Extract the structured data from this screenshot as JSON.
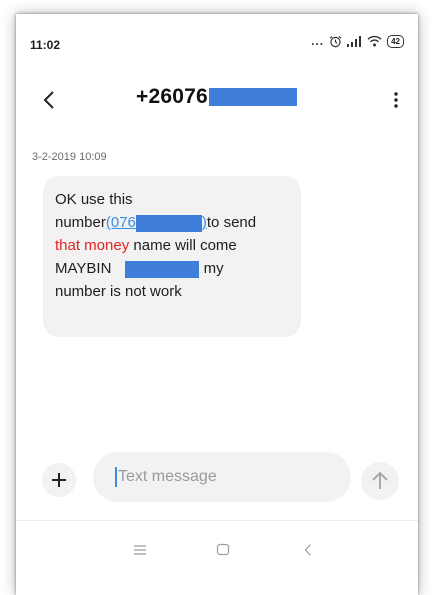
{
  "status_bar": {
    "time": "11:02",
    "dots": "...",
    "battery": "42",
    "icons": [
      "alarm-icon",
      "signal-icon",
      "wifi-icon",
      "battery-icon"
    ]
  },
  "header": {
    "title": "+26076",
    "back_icon": "chevron-left-icon",
    "more_icon": "more-vertical-icon"
  },
  "conversation": {
    "timestamp": "3-2-2019 10:09",
    "message": {
      "line1": "OK use this",
      "line2_prefix": "number",
      "line2_link": "(076",
      "line2_link_close": ")",
      "line2_suffix": "to send",
      "line3_highlight": "that money",
      "line3_suffix": " name will come",
      "line4_prefix": "MAYBIN",
      "line4_suffix": " my",
      "line5": "number is not work"
    }
  },
  "composer": {
    "placeholder": "Text message",
    "add_icon": "plus-icon",
    "send_icon": "arrow-up-icon"
  },
  "nav_bar": {
    "items": [
      "menu-icon",
      "home-icon",
      "back-icon"
    ]
  },
  "colors": {
    "link": "#3a8ee0",
    "highlight": "#e02424",
    "redaction": "#3f7fd9",
    "bubble": "#f2f2f2"
  }
}
